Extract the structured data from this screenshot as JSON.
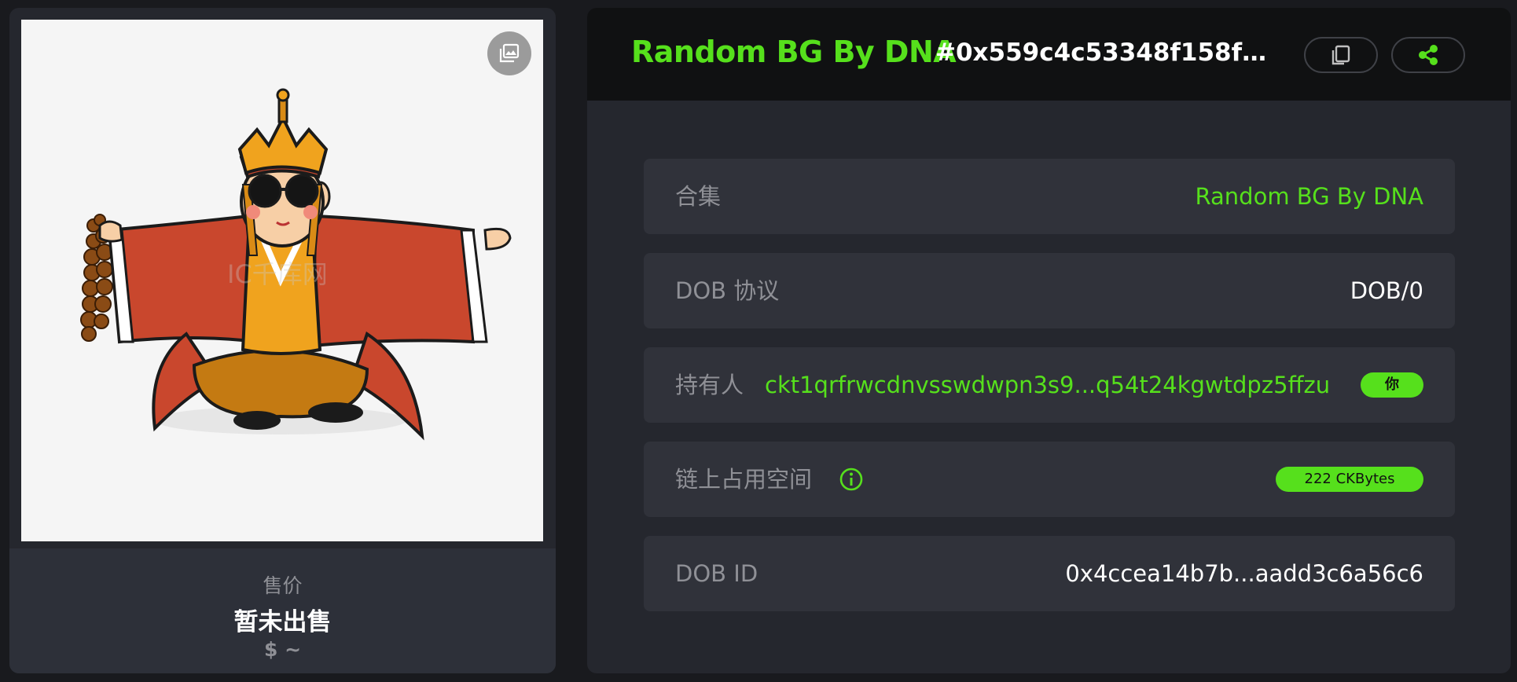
{
  "nft": {
    "image_alt": "monk character illustration",
    "watermark": "IC千库网"
  },
  "price": {
    "label": "售价",
    "value": "暂未出售",
    "usd": "$ ~"
  },
  "header": {
    "collection_title": "Random BG By DNA",
    "token_id": "#0x559c4c53348f158f3b7...",
    "copy_icon": "copy-icon",
    "share_icon": "share-icon"
  },
  "details": {
    "collection": {
      "label": "合集",
      "value": "Random BG By DNA"
    },
    "protocol": {
      "label": "DOB 协议",
      "value": "DOB/0"
    },
    "owner": {
      "label": "持有人",
      "address": "ckt1qrfrwcdnvsswdwpn3s9...q54t24kgwtdpz5ffzu",
      "badge": "你"
    },
    "storage": {
      "label": "链上占用空间",
      "value": "222 CKBytes"
    },
    "dob_id": {
      "label": "DOB ID",
      "value": "0x4ccea14b7b...aadd3c6a56c6"
    }
  },
  "colors": {
    "accent": "#56e01c",
    "background": "#191a1e",
    "panel": "#25272e",
    "row": "#30323a"
  }
}
